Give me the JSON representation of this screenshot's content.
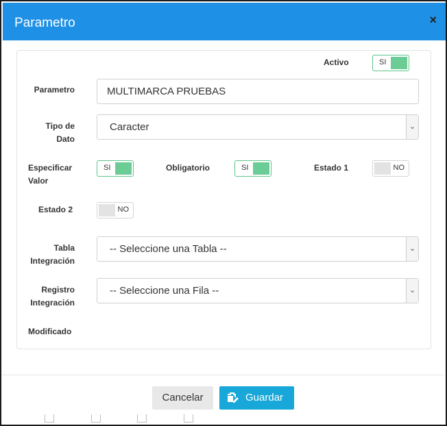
{
  "modal": {
    "title": "Parametro",
    "close_icon": "×"
  },
  "form": {
    "activo": {
      "label": "Activo",
      "toggle": "SI",
      "state": "on"
    },
    "parametro": {
      "label": "Parametro",
      "value": "MULTIMARCA PRUEBAS"
    },
    "tipo_dato": {
      "label_line1": "Tipo de",
      "label_line2": "Dato",
      "value": "Caracter"
    },
    "especificar_valor": {
      "label_line1": "Especificar",
      "label_line2": "Valor",
      "toggle": "SI",
      "state": "on"
    },
    "obligatorio": {
      "label": "Obligatorio",
      "toggle": "SI",
      "state": "on"
    },
    "estado1": {
      "label": "Estado 1",
      "toggle": "NO",
      "state": "off"
    },
    "estado2": {
      "label": "Estado 2",
      "toggle": "NO",
      "state": "off"
    },
    "tabla_integracion": {
      "label_line1": "Tabla",
      "label_line2": "Integración",
      "value": "-- Seleccione una Tabla --"
    },
    "registro_integracion": {
      "label_line1": "Registro",
      "label_line2": "Integración",
      "value": "-- Seleccione una Fila --"
    },
    "modificado": {
      "label": "Modificado"
    }
  },
  "footer": {
    "cancel_label": "Cancelar",
    "save_label": "Guardar",
    "save_icon": "save-edit-icon"
  },
  "colors": {
    "header": "#1e90e6",
    "toggle_on": "#6ccc95",
    "save_button": "#17a7d8"
  }
}
